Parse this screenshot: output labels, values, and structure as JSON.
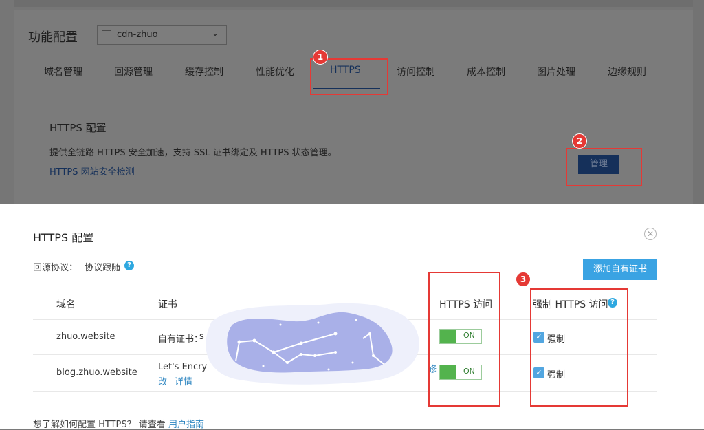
{
  "top": {
    "section_title": "功能配置",
    "domain_select": {
      "value": "cdn-zhuo"
    },
    "tabs": [
      {
        "label": "域名管理"
      },
      {
        "label": "回源管理"
      },
      {
        "label": "缓存控制"
      },
      {
        "label": "性能优化"
      },
      {
        "label": "HTTPS",
        "active": true
      },
      {
        "label": "访问控制"
      },
      {
        "label": "成本控制"
      },
      {
        "label": "图片处理"
      },
      {
        "label": "边缘规则"
      }
    ],
    "https_block": {
      "title": "HTTPS 配置",
      "description": "提供全链路 HTTPS 安全加速，支持 SSL 证书绑定及 HTTPS 状态管理。",
      "link": "HTTPS 网站安全检测",
      "manage_label": "管理"
    }
  },
  "annotations": {
    "badges": [
      "1",
      "2",
      "3"
    ],
    "color": "#e53935"
  },
  "modal": {
    "title": "HTTPS 配置",
    "protocol_label": "回源协议：",
    "protocol_value": "协议跟随",
    "add_cert_label": "添加自有证书",
    "columns": {
      "domain": "域名",
      "cert": "证书",
      "https": "HTTPS 访问",
      "force": "强制 HTTPS 访问"
    },
    "rows": [
      {
        "domain": "zhuo.website",
        "cert": "自有证书：",
        "cert_trailing": "s",
        "https": "ON",
        "force": "强制"
      },
      {
        "domain": "blog.zhuo.website",
        "cert": "Let's Encry",
        "cert_trailing": "修",
        "cert_link_1": "改",
        "cert_link_2": "详情",
        "https": "ON",
        "force": "强制"
      }
    ],
    "footer_prefix": "想了解如何配置 HTTPS？ 请查看",
    "footer_link": "用户指南"
  },
  "colors": {
    "accent": "#3aa3e3",
    "toggle_on": "#53b34d",
    "tab_active": "#15305a",
    "annotation": "#e53935"
  }
}
